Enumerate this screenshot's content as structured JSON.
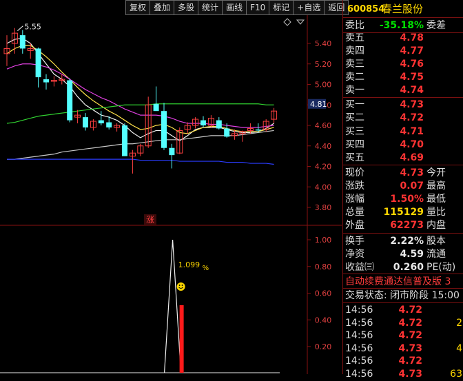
{
  "toolbar": [
    "复权",
    "叠加",
    "多股",
    "统计",
    "画线",
    "F10",
    "标记",
    "+自选",
    "返回"
  ],
  "stock": {
    "code": "600854",
    "name": "春兰股份"
  },
  "quote_rows": [
    {
      "label": "委比",
      "value": "-35.18%",
      "value_color": "green",
      "tail": "委差"
    },
    {
      "label": "卖五",
      "value": "4.78",
      "value_color": "red",
      "tail": ""
    },
    {
      "label": "卖四",
      "value": "4.77",
      "value_color": "red",
      "tail": ""
    },
    {
      "label": "卖三",
      "value": "4.76",
      "value_color": "red",
      "tail": ""
    },
    {
      "label": "卖二",
      "value": "4.75",
      "value_color": "red",
      "tail": ""
    },
    {
      "label": "卖一",
      "value": "4.74",
      "value_color": "red",
      "tail": ""
    },
    {
      "label": "买一",
      "value": "4.73",
      "value_color": "red",
      "tail": ""
    },
    {
      "label": "买二",
      "value": "4.72",
      "value_color": "red",
      "tail": ""
    },
    {
      "label": "买三",
      "value": "4.71",
      "value_color": "red",
      "tail": ""
    },
    {
      "label": "买四",
      "value": "4.70",
      "value_color": "red",
      "tail": ""
    },
    {
      "label": "买五",
      "value": "4.69",
      "value_color": "red",
      "tail": ""
    },
    {
      "label": "现价",
      "value": "4.73",
      "value_color": "red",
      "tail": "今开"
    },
    {
      "label": "涨跌",
      "value": "0.07",
      "value_color": "red",
      "tail": "最高"
    },
    {
      "label": "涨幅",
      "value": "1.50%",
      "value_color": "red",
      "tail": "最低"
    },
    {
      "label": "总量",
      "value": "115129",
      "value_color": "yellow",
      "tail": "量比"
    },
    {
      "label": "外盘",
      "value": "62273",
      "value_color": "red",
      "tail": "内盘"
    },
    {
      "label": "换手",
      "value": "2.22%",
      "value_color": "white",
      "tail": "股本"
    },
    {
      "label": "净资",
      "value": "4.59",
      "value_color": "white",
      "tail": "流通"
    },
    {
      "label": "收益㈢",
      "value": "0.260",
      "value_color": "white",
      "tail": "PE(动)"
    }
  ],
  "promo_text": "自动续费通达信普及版 3",
  "trade_status": "交易状态: 闭市阶段 15:00",
  "ticks": [
    {
      "time": "14:56",
      "price": "4.72",
      "vol": ""
    },
    {
      "time": "14:56",
      "price": "4.72",
      "vol": "2"
    },
    {
      "time": "14:56",
      "price": "4.72",
      "vol": ""
    },
    {
      "time": "14:56",
      "price": "4.73",
      "vol": "4"
    },
    {
      "time": "14:56",
      "price": "4.72",
      "vol": ""
    },
    {
      "time": "14:56",
      "price": "4.73",
      "vol": "63"
    }
  ],
  "chart_data": [
    {
      "type": "candlestick",
      "y_ticks": [
        "5.40",
        "5.20",
        "5.00",
        "4.80",
        "4.60",
        "4.40",
        "4.20",
        "4.00",
        "3.80"
      ],
      "ylim": [
        3.7,
        5.6
      ],
      "current_price_tag": "4.81",
      "high_marker": "5.55",
      "candles": [
        {
          "o": 5.3,
          "h": 5.48,
          "l": 5.18,
          "c": 5.35
        },
        {
          "o": 5.4,
          "h": 5.55,
          "l": 5.3,
          "c": 5.5
        },
        {
          "o": 5.48,
          "h": 5.53,
          "l": 5.3,
          "c": 5.35
        },
        {
          "o": 5.33,
          "h": 5.4,
          "l": 5.25,
          "c": 5.35
        },
        {
          "o": 5.35,
          "h": 5.36,
          "l": 4.97,
          "c": 5.07
        },
        {
          "o": 5.05,
          "h": 5.1,
          "l": 4.95,
          "c": 5.02
        },
        {
          "o": 5.03,
          "h": 5.08,
          "l": 4.98,
          "c": 5.04
        },
        {
          "o": 5.04,
          "h": 5.1,
          "l": 5.0,
          "c": 5.05
        },
        {
          "o": 5.04,
          "h": 5.06,
          "l": 4.63,
          "c": 4.65
        },
        {
          "o": 4.68,
          "h": 4.75,
          "l": 4.62,
          "c": 4.7
        },
        {
          "o": 4.68,
          "h": 4.72,
          "l": 4.55,
          "c": 4.58
        },
        {
          "o": 4.58,
          "h": 4.66,
          "l": 4.55,
          "c": 4.64
        },
        {
          "o": 4.65,
          "h": 4.74,
          "l": 4.6,
          "c": 4.62
        },
        {
          "o": 4.63,
          "h": 4.69,
          "l": 4.56,
          "c": 4.58
        },
        {
          "o": 4.58,
          "h": 4.62,
          "l": 4.54,
          "c": 4.6
        },
        {
          "o": 4.6,
          "h": 4.62,
          "l": 4.3,
          "c": 4.3
        },
        {
          "o": 4.3,
          "h": 4.36,
          "l": 4.13,
          "c": 4.33
        },
        {
          "o": 4.33,
          "h": 4.42,
          "l": 4.3,
          "c": 4.4
        },
        {
          "o": 4.4,
          "h": 4.88,
          "l": 4.38,
          "c": 4.8
        },
        {
          "o": 4.81,
          "h": 4.98,
          "l": 4.76,
          "c": 4.74
        },
        {
          "o": 4.74,
          "h": 4.82,
          "l": 4.36,
          "c": 4.38
        },
        {
          "o": 4.38,
          "h": 4.42,
          "l": 4.18,
          "c": 4.31
        },
        {
          "o": 4.33,
          "h": 4.58,
          "l": 4.32,
          "c": 4.55
        },
        {
          "o": 4.56,
          "h": 4.63,
          "l": 4.52,
          "c": 4.6
        },
        {
          "o": 4.6,
          "h": 4.68,
          "l": 4.57,
          "c": 4.66
        },
        {
          "o": 4.65,
          "h": 4.69,
          "l": 4.58,
          "c": 4.6
        },
        {
          "o": 4.6,
          "h": 4.7,
          "l": 4.58,
          "c": 4.67
        },
        {
          "o": 4.65,
          "h": 4.68,
          "l": 4.56,
          "c": 4.57
        },
        {
          "o": 4.57,
          "h": 4.62,
          "l": 4.48,
          "c": 4.49
        },
        {
          "o": 4.5,
          "h": 4.56,
          "l": 4.46,
          "c": 4.52
        },
        {
          "o": 4.52,
          "h": 4.55,
          "l": 4.44,
          "c": 4.54
        },
        {
          "o": 4.55,
          "h": 4.62,
          "l": 4.52,
          "c": 4.57
        },
        {
          "o": 4.56,
          "h": 4.62,
          "l": 4.53,
          "c": 4.55
        },
        {
          "o": 4.56,
          "h": 4.66,
          "l": 4.54,
          "c": 4.64
        },
        {
          "o": 4.66,
          "h": 4.77,
          "l": 4.62,
          "c": 4.74
        }
      ],
      "ma_lines": [
        {
          "color": "#f0f0f0",
          "points": [
            5.4,
            5.44,
            5.45,
            5.4,
            5.3,
            5.2,
            5.1,
            5.05,
            4.98,
            4.88,
            4.8,
            4.75,
            4.7,
            4.68,
            4.65,
            4.6,
            4.53,
            4.48,
            4.52,
            4.55,
            4.55,
            4.5,
            4.45,
            4.5,
            4.56,
            4.58,
            4.58,
            4.58,
            4.56,
            4.54,
            4.53,
            4.53,
            4.54,
            4.57,
            4.62
          ]
        },
        {
          "color": "#ffe24a",
          "points": [
            5.3,
            5.35,
            5.38,
            5.38,
            5.33,
            5.27,
            5.2,
            5.12,
            5.05,
            4.97,
            4.9,
            4.84,
            4.79,
            4.74,
            4.7,
            4.65,
            4.6,
            4.56,
            4.57,
            4.6,
            4.61,
            4.58,
            4.53,
            4.52,
            4.55,
            4.58,
            4.59,
            4.59,
            4.57,
            4.55,
            4.54,
            4.54,
            4.54,
            4.56,
            4.58
          ]
        },
        {
          "color": "#e040e0",
          "points": [
            5.15,
            5.18,
            5.2,
            5.2,
            5.19,
            5.17,
            5.14,
            5.1,
            5.05,
            5.0,
            4.95,
            4.91,
            4.87,
            4.84,
            4.8,
            4.76,
            4.73,
            4.7,
            4.7,
            4.7,
            4.69,
            4.67,
            4.64,
            4.62,
            4.62,
            4.62,
            4.61,
            4.61,
            4.6,
            4.59,
            4.58,
            4.58,
            4.58,
            4.59,
            4.6
          ]
        },
        {
          "color": "#30d030",
          "points": [
            4.62,
            4.63,
            4.65,
            4.67,
            4.69,
            4.7,
            4.71,
            4.72,
            4.73,
            4.74,
            4.75,
            4.76,
            4.77,
            4.78,
            4.79,
            4.8,
            4.8,
            4.8,
            4.8,
            4.81,
            4.81,
            4.81,
            4.81,
            4.81,
            4.81,
            4.81,
            4.81,
            4.81,
            4.81,
            4.81,
            4.81,
            4.81,
            4.81,
            4.8,
            4.8
          ]
        },
        {
          "color": "#c8c8c8",
          "points": [
            4.27,
            4.27,
            4.28,
            4.29,
            4.3,
            4.31,
            4.32,
            4.34,
            4.35,
            4.36,
            4.37,
            4.38,
            4.39,
            4.4,
            4.41,
            4.42,
            4.42,
            4.43,
            4.44,
            4.45,
            4.46,
            4.46,
            4.46,
            4.47,
            4.48,
            4.49,
            4.5,
            4.5,
            4.5,
            4.5,
            4.51,
            4.52,
            4.53,
            4.54,
            4.55
          ]
        },
        {
          "color": "#2b3cff",
          "points": [
            4.27,
            4.27,
            4.27,
            4.27,
            4.27,
            4.27,
            4.27,
            4.27,
            4.27,
            4.27,
            4.27,
            4.27,
            4.27,
            4.27,
            4.27,
            4.27,
            4.27,
            4.26,
            4.26,
            4.26,
            4.26,
            4.26,
            4.25,
            4.25,
            4.25,
            4.25,
            4.25,
            4.25,
            4.24,
            4.24,
            4.24,
            4.23,
            4.23,
            4.23,
            4.22
          ]
        }
      ]
    },
    {
      "type": "line",
      "y_ticks": [
        "1.00",
        "0.80",
        "0.60",
        "0.40",
        "0.20"
      ],
      "ylim": [
        0,
        1.05
      ],
      "annotation": "1.099",
      "annotation_unit": "%",
      "badge": "涨",
      "spike": [
        {
          "x_index": 19,
          "value": 1.0
        }
      ],
      "bar": {
        "x_index": 21,
        "value": 0.51
      }
    }
  ]
}
